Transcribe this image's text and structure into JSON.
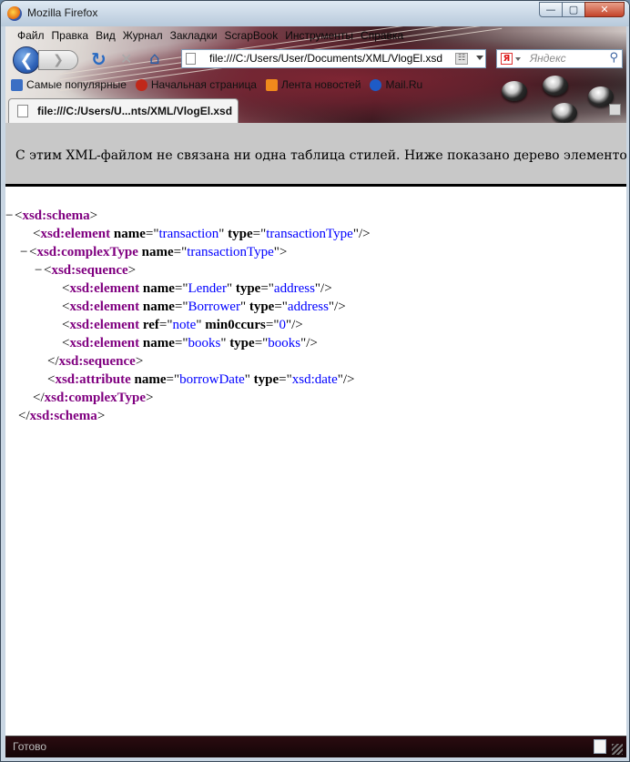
{
  "window": {
    "title": "Mozilla Firefox",
    "buttons": {
      "minimize": "—",
      "maximize": "▢",
      "close": "✕"
    }
  },
  "menubar": {
    "items": [
      "Файл",
      "Правка",
      "Вид",
      "Журнал",
      "Закладки",
      "ScrapBook",
      "Инструменты",
      "Справка"
    ]
  },
  "navbar": {
    "back": "❮",
    "forward": "❯",
    "reload": "↻",
    "stop": "✕",
    "home": "⌂",
    "url": "file:///C:/Users/User/Documents/XML/VlogEl.xsd",
    "search_placeholder": "Яндекс",
    "search_engine_label": "Я"
  },
  "bookmarks": {
    "items": [
      {
        "label": "Самые популярные",
        "icon": "popular-icon",
        "color": "#3b6fc4"
      },
      {
        "label": "Начальная страница",
        "icon": "firefox-start-icon",
        "color": "#c0281a"
      },
      {
        "label": "Лента новостей",
        "icon": "rss-icon",
        "color": "#f08a1c"
      },
      {
        "label": "Mail.Ru",
        "icon": "mailru-icon",
        "color": "#1e5bc6"
      }
    ]
  },
  "tabs": [
    {
      "label": "file:///C:/Users/U...nts/XML/VlogEl.xsd",
      "active": true
    }
  ],
  "content": {
    "info_message": "С этим XML-файлом не связана ни одна таблица стилей. Ниже показано дерево элементов.",
    "tree": [
      {
        "indent": 0,
        "toggle": "−",
        "parts": [
          [
            "p",
            "<"
          ],
          [
            "t",
            "xsd:schema"
          ],
          [
            "p",
            ">"
          ]
        ]
      },
      {
        "indent": 1,
        "toggle": "",
        "parts": [
          [
            "p",
            "<"
          ],
          [
            "t",
            "xsd:element"
          ],
          [
            "p",
            " "
          ],
          [
            "a",
            "name"
          ],
          [
            "p",
            "=\""
          ],
          [
            "v",
            "transaction"
          ],
          [
            "p",
            "\" "
          ],
          [
            "a",
            "type"
          ],
          [
            "p",
            "=\""
          ],
          [
            "v",
            "transactionType"
          ],
          [
            "p",
            "\"/>"
          ]
        ]
      },
      {
        "indent": 1,
        "toggle": "−",
        "parts": [
          [
            "p",
            "<"
          ],
          [
            "t",
            "xsd:complexType"
          ],
          [
            "p",
            " "
          ],
          [
            "a",
            "name"
          ],
          [
            "p",
            "=\""
          ],
          [
            "v",
            "transactionType"
          ],
          [
            "p",
            "\">"
          ]
        ]
      },
      {
        "indent": 2,
        "toggle": "−",
        "parts": [
          [
            "p",
            "<"
          ],
          [
            "t",
            "xsd:sequence"
          ],
          [
            "p",
            ">"
          ]
        ]
      },
      {
        "indent": 3,
        "toggle": "",
        "parts": [
          [
            "p",
            "<"
          ],
          [
            "t",
            "xsd:element"
          ],
          [
            "p",
            " "
          ],
          [
            "a",
            "name"
          ],
          [
            "p",
            "=\""
          ],
          [
            "v",
            "Lender"
          ],
          [
            "p",
            "\" "
          ],
          [
            "a",
            "type"
          ],
          [
            "p",
            "=\""
          ],
          [
            "v",
            "address"
          ],
          [
            "p",
            "\"/>"
          ]
        ]
      },
      {
        "indent": 3,
        "toggle": "",
        "parts": [
          [
            "p",
            "<"
          ],
          [
            "t",
            "xsd:element"
          ],
          [
            "p",
            " "
          ],
          [
            "a",
            "name"
          ],
          [
            "p",
            "=\""
          ],
          [
            "v",
            "Borrower"
          ],
          [
            "p",
            "\" "
          ],
          [
            "a",
            "type"
          ],
          [
            "p",
            "=\""
          ],
          [
            "v",
            "address"
          ],
          [
            "p",
            "\"/>"
          ]
        ]
      },
      {
        "indent": 3,
        "toggle": "",
        "parts": [
          [
            "p",
            "<"
          ],
          [
            "t",
            "xsd:element"
          ],
          [
            "p",
            " "
          ],
          [
            "a",
            "ref"
          ],
          [
            "p",
            "=\""
          ],
          [
            "v",
            "note"
          ],
          [
            "p",
            "\" "
          ],
          [
            "a",
            "min0ccurs"
          ],
          [
            "p",
            "=\""
          ],
          [
            "v",
            "0"
          ],
          [
            "p",
            "\"/>"
          ]
        ]
      },
      {
        "indent": 3,
        "toggle": "",
        "parts": [
          [
            "p",
            "<"
          ],
          [
            "t",
            "xsd:element"
          ],
          [
            "p",
            " "
          ],
          [
            "a",
            "name"
          ],
          [
            "p",
            "=\""
          ],
          [
            "v",
            "books"
          ],
          [
            "p",
            "\" "
          ],
          [
            "a",
            "type"
          ],
          [
            "p",
            "=\""
          ],
          [
            "v",
            "books"
          ],
          [
            "p",
            "\"/>"
          ]
        ]
      },
      {
        "indent": 2,
        "toggle": "",
        "parts": [
          [
            "p",
            "</"
          ],
          [
            "t",
            "xsd:sequence"
          ],
          [
            "p",
            ">"
          ]
        ]
      },
      {
        "indent": 2,
        "toggle": "",
        "parts": [
          [
            "p",
            "<"
          ],
          [
            "t",
            "xsd:attribute"
          ],
          [
            "p",
            " "
          ],
          [
            "a",
            "name"
          ],
          [
            "p",
            "=\""
          ],
          [
            "v",
            "borrowDate"
          ],
          [
            "p",
            "\" "
          ],
          [
            "a",
            "type"
          ],
          [
            "p",
            "=\""
          ],
          [
            "v",
            "xsd:date"
          ],
          [
            "p",
            "\"/>"
          ]
        ]
      },
      {
        "indent": 1,
        "toggle": "",
        "parts": [
          [
            "p",
            "</"
          ],
          [
            "t",
            "xsd:complexType"
          ],
          [
            "p",
            ">"
          ]
        ]
      },
      {
        "indent": 0,
        "toggle": "",
        "parts": [
          [
            "p",
            "</"
          ],
          [
            "t",
            "xsd:schema"
          ],
          [
            "p",
            ">"
          ]
        ]
      }
    ]
  },
  "status": {
    "text": "Готово"
  }
}
